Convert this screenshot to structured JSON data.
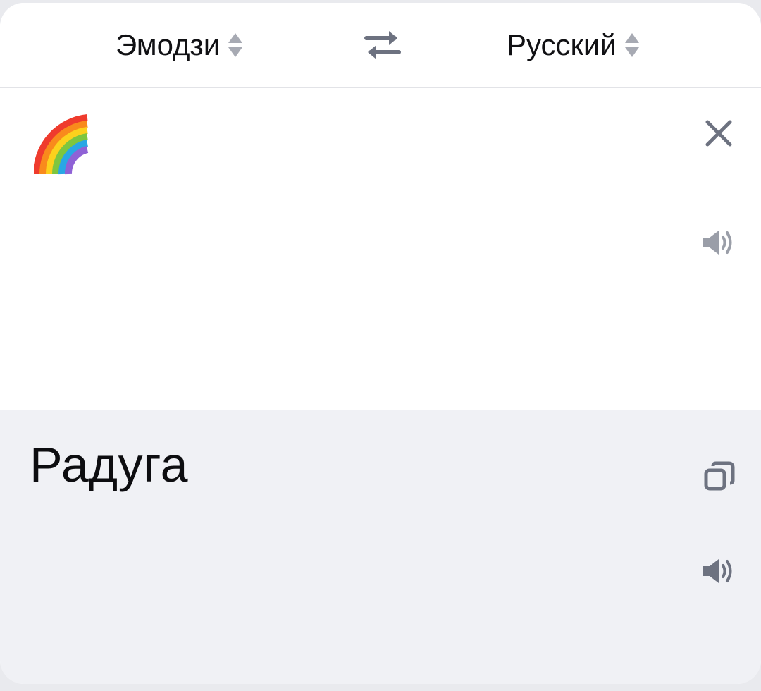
{
  "header": {
    "source_language": "Эмодзи",
    "target_language": "Русский",
    "swap_icon": "swap-arrows-icon"
  },
  "input": {
    "text_icon": "rainbow-emoji",
    "clear_icon": "close-icon",
    "speak_icon": "speaker-icon"
  },
  "output": {
    "text": "Радуга",
    "copy_icon": "copy-icon",
    "speak_icon": "speaker-icon"
  },
  "colors": {
    "icon_gray": "#6d7280",
    "arrow_gray": "#9a9ea8",
    "output_bg": "#f0f1f5"
  }
}
